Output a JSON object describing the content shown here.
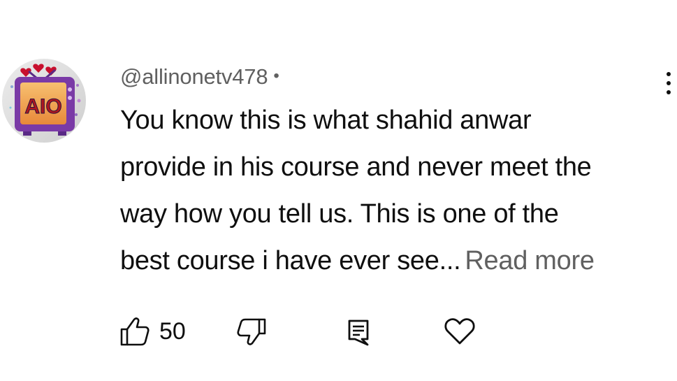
{
  "comment": {
    "author": "@allinonetv478",
    "separator": "•",
    "text_lines": [
      "You know this is what shahid anwar",
      "provide in his course and never meet the",
      "way how you tell us. This is one of the",
      "best course i have ever see..."
    ],
    "read_more_label": "Read more",
    "avatar_text": "AIO",
    "like_count": "50"
  },
  "icons": {
    "like": "thumbs-up-icon",
    "dislike": "thumbs-down-icon",
    "reply": "reply-comment-icon",
    "heart": "heart-icon",
    "more": "vertical-ellipsis-icon"
  },
  "colors": {
    "text_primary": "#0f0f0f",
    "text_secondary": "#606060",
    "avatar_bg": "#d8d8d8",
    "avatar_tv": "#7a3aa6",
    "avatar_screen": "#f2a245",
    "avatar_hearts": "#c8102e"
  }
}
